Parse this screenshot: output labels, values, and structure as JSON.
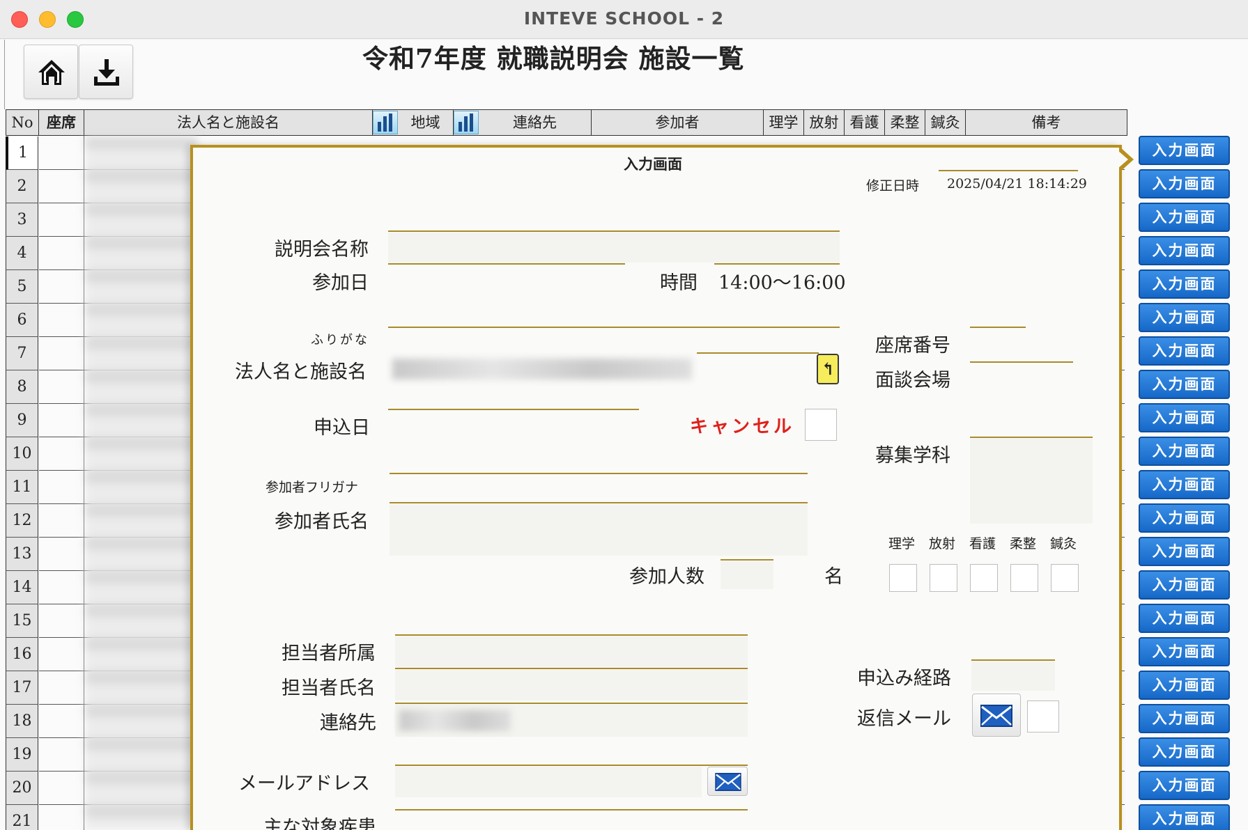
{
  "window": {
    "title": "INTEVE SCHOOL - 2"
  },
  "page": {
    "title": "令和7年度 就職説明会 施設一覧"
  },
  "table": {
    "headers": {
      "no": "No",
      "seat": "座席",
      "name": "法人名と施設名",
      "region": "地域",
      "contact": "連絡先",
      "attendee": "参加者",
      "rigaku": "理学",
      "hosha": "放射",
      "kango": "看護",
      "jusei": "柔整",
      "shinkyu": "鍼灸",
      "notes": "備考"
    },
    "rows": [
      "1",
      "2",
      "3",
      "4",
      "5",
      "6",
      "7",
      "8",
      "9",
      "10",
      "11",
      "12",
      "13",
      "14",
      "15",
      "16",
      "17",
      "18",
      "19",
      "20",
      "21"
    ],
    "side_button_label": "入力画面"
  },
  "dialog": {
    "title": "入力画面",
    "modified_label": "修正日時",
    "modified_value": "2025/04/21 18:14:29",
    "session_name_label": "説明会名称",
    "date_label": "参加日",
    "time_label": "時間",
    "time_value": "14:00〜16:00",
    "furigana_label": "ふりがな",
    "facility_label": "法人名と施設名",
    "seat_no_label": "座席番号",
    "venue_label": "面談会場",
    "apply_date_label": "申込日",
    "cancel_label": "キャンセル",
    "dept_label": "募集学科",
    "attendee_kana_label": "参加者フリガナ",
    "attendee_name_label": "参加者氏名",
    "attendee_count_label": "参加人数",
    "attendee_count_unit": "名",
    "dept_checks": [
      "理学",
      "放射",
      "看護",
      "柔整",
      "鍼灸"
    ],
    "staff_dept_label": "担当者所属",
    "staff_name_label": "担当者氏名",
    "contact_label": "連絡先",
    "route_label": "申込み経路",
    "reply_mail_label": "返信メール",
    "email_label": "メールアドレス",
    "main_disease_label": "主な対象疾患"
  },
  "icons": {
    "home": "home-icon",
    "download": "download-icon",
    "chart": "bar-chart-icon",
    "mail": "mail-icon",
    "jump": "return-arrow-icon"
  },
  "colors": {
    "accent_gold": "#b8901e",
    "button_blue": "#1668c8",
    "cancel_red": "#e0201a"
  }
}
